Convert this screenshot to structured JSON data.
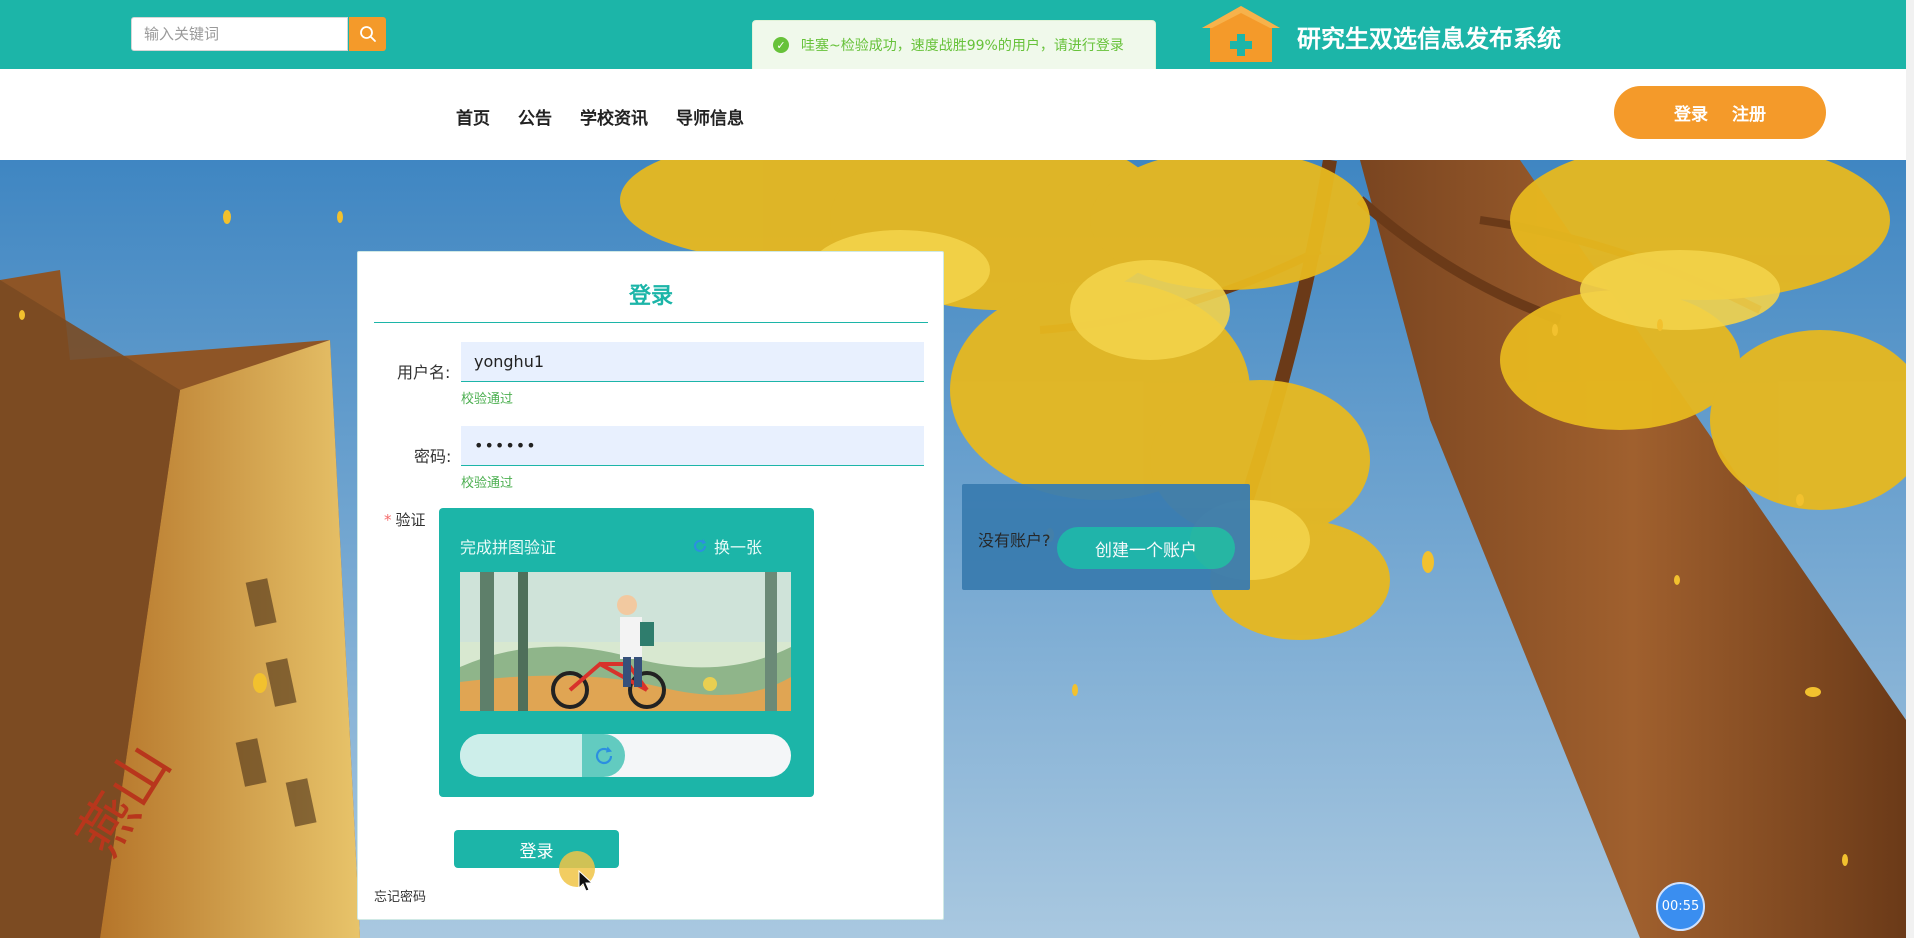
{
  "header": {
    "search_placeholder": "输入关键词",
    "toast_message": "哇塞~检验成功，速度战胜99%的用户，请进行登录",
    "site_title": "研究生双选信息发布系统"
  },
  "nav": {
    "items": [
      {
        "label": "首页"
      },
      {
        "label": "公告"
      },
      {
        "label": "学校资讯"
      },
      {
        "label": "导师信息"
      }
    ],
    "login_label": "登录",
    "register_label": "注册"
  },
  "login": {
    "title": "登录",
    "username_label": "用户名:",
    "username_value": "yonghu1",
    "username_valid": "校验通过",
    "password_label": "密码:",
    "password_value": "••••••",
    "password_valid": "校验通过",
    "captcha_label": "验证",
    "captcha_title": "完成拼图验证",
    "captcha_refresh": "换一张",
    "slider_progress": 0.37,
    "submit_label": "登录",
    "forgot_label": "忘记密码"
  },
  "register": {
    "question": "没有账户?",
    "button_label": "创建一个账户"
  },
  "timer": "00:55",
  "colors": {
    "primary": "#1cb5a8",
    "accent": "#f49a2a",
    "success": "#67c23a"
  }
}
